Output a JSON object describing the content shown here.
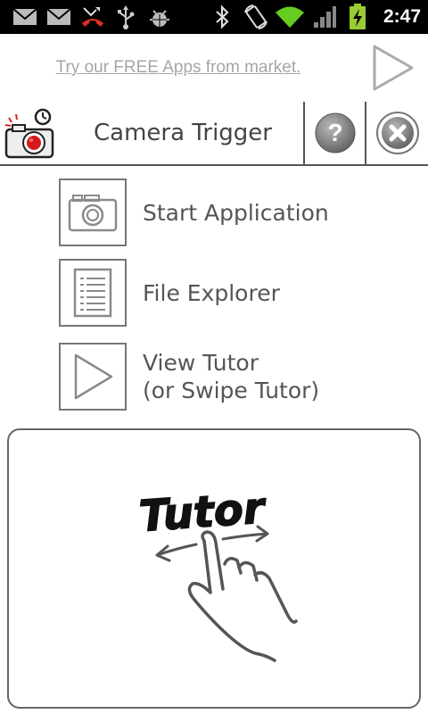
{
  "status_bar": {
    "time": "2:47",
    "icons": [
      "gmail-icon",
      "gmail-icon",
      "missed-call-icon",
      "usb-icon",
      "android-debug-icon",
      "bluetooth-icon",
      "rotate-icon",
      "wifi-icon",
      "signal-icon",
      "battery-charging-icon"
    ]
  },
  "ad": {
    "text": "Try our FREE Apps from market.",
    "icon": "play-icon"
  },
  "header": {
    "title": "Camera Trigger",
    "app_icon": "camera-timer-icon",
    "help_icon": "help-icon",
    "close_icon": "close-icon"
  },
  "menu": {
    "items": [
      {
        "icon": "camera-icon",
        "line1": "Start Application",
        "line2": ""
      },
      {
        "icon": "document-list-icon",
        "line1": "File Explorer",
        "line2": ""
      },
      {
        "icon": "play-icon",
        "line1": "View Tutor",
        "line2": "(or Swipe Tutor)"
      }
    ]
  },
  "tutor": {
    "text": "Tutor",
    "icon": "swipe-hand-icon"
  },
  "colors": {
    "status_bar_bg": "#000000",
    "wifi_green": "#66cc22",
    "battery_green": "#99cc33",
    "ad_text": "#a6a6a6",
    "text_gray": "#555555",
    "border_gray": "#777777"
  }
}
